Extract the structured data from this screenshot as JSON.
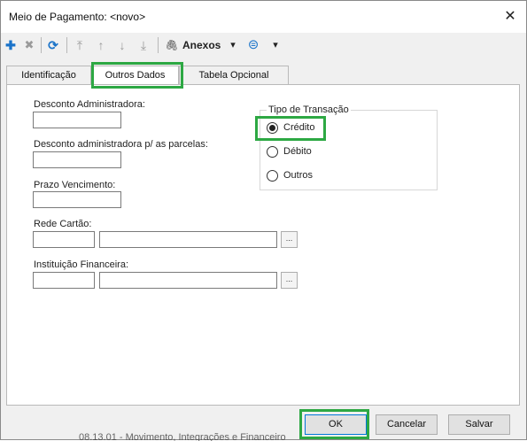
{
  "window": {
    "title": "Meio de Pagamento: <novo>",
    "close_label": "✕"
  },
  "toolbar": {
    "add_glyph": "✚",
    "delete_glyph": "✖",
    "refresh_glyph": "⟳",
    "first_glyph": "⤒",
    "up_glyph": "↑",
    "down_glyph": "↓",
    "last_glyph": "⤓",
    "anexos_glyph": "🖇",
    "anexos_label": "Anexos",
    "dropdown_glyph": "▾",
    "disk_glyph": "⊜"
  },
  "tabs": [
    {
      "label": "Identificação"
    },
    {
      "label": "Outros Dados"
    },
    {
      "label": "Tabela Opcional"
    }
  ],
  "form": {
    "desconto_administradora_label": "Desconto Administradora:",
    "desconto_administradora_value": "",
    "desconto_parcelas_label": "Desconto administradora p/ as parcelas:",
    "desconto_parcelas_value": "",
    "prazo_vencimento_label": "Prazo Vencimento:",
    "prazo_vencimento_value": "",
    "rede_cartao_label": "Rede Cartão:",
    "rede_cartao_code": "",
    "rede_cartao_desc": "",
    "instituicao_label": "Instituição Financeira:",
    "instituicao_code": "",
    "instituicao_desc": "",
    "browse_label": "..."
  },
  "tipo_transacao": {
    "title": "Tipo de Transação",
    "options": [
      {
        "label": "Crédito",
        "checked": true
      },
      {
        "label": "Débito",
        "checked": false
      },
      {
        "label": "Outros",
        "checked": false
      }
    ]
  },
  "buttons": {
    "ok": "OK",
    "cancel": "Cancelar",
    "save": "Salvar"
  },
  "background_text": "08.13.01 - Movimento, Integrações e Financeiro",
  "colors": {
    "highlight": "#2da843",
    "add_icon": "#1a73c9",
    "refresh_icon": "#1a73c9"
  }
}
